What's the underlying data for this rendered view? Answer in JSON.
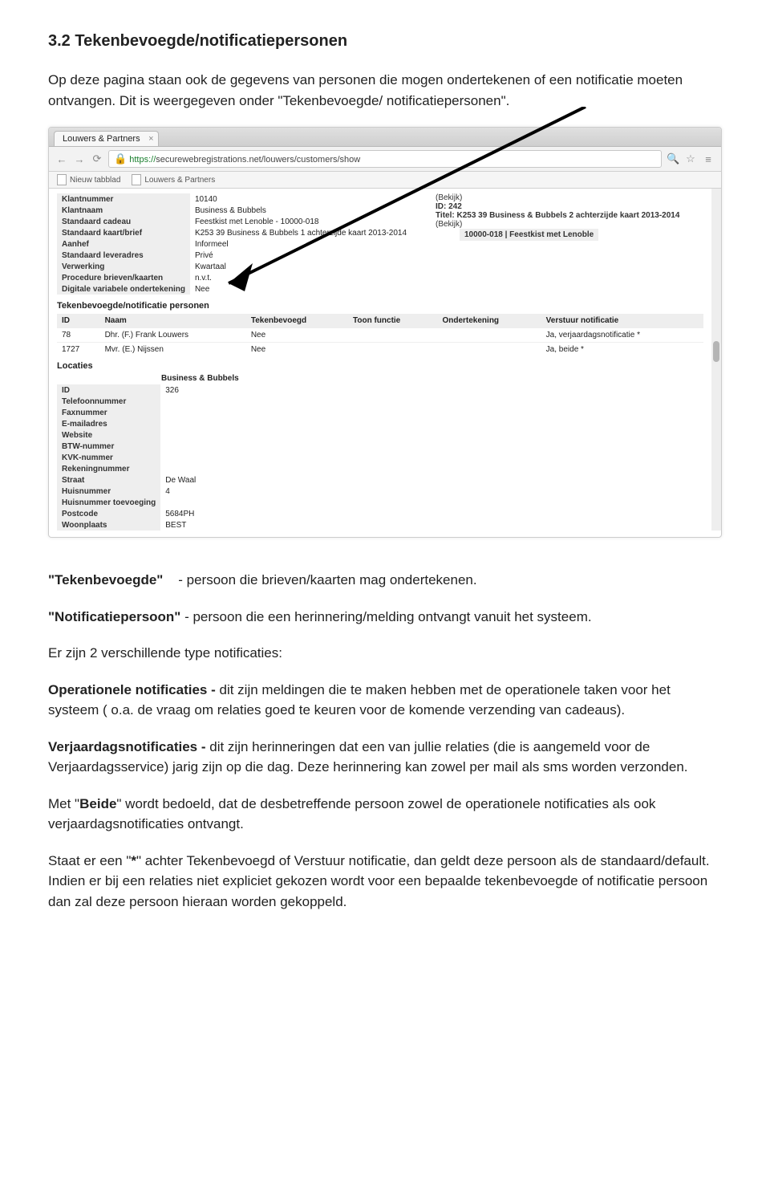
{
  "section_title": "3.2 Tekenbevoegde/notificatiepersonen",
  "intro1": "Op deze pagina staan ook de gegevens van  personen die mogen ondertekenen of een notificatie moeten ontvangen. Dit is weergegeven onder \"Tekenbevoegde/ notificatiepersonen\".",
  "browser": {
    "tab": "Louwers & Partners",
    "url_prefix": "https://",
    "url_rest": "securewebregistrations.net/louwers/customers/show",
    "bookmark1": "Nieuw tabblad",
    "bookmark2": "Louwers & Partners"
  },
  "details": {
    "rows": [
      {
        "k": "Klantnummer",
        "v": "10140"
      },
      {
        "k": "Klantnaam",
        "v": "Business & Bubbels"
      },
      {
        "k": "Standaard cadeau",
        "v": "Feestkist met Lenoble - 10000-018"
      },
      {
        "k": "Standaard kaart/brief",
        "v": "K253 39 Business & Bubbels 1 achterzijde kaart 2013-2014"
      },
      {
        "k": "Aanhef",
        "v": "Informeel"
      },
      {
        "k": "Standaard leveradres",
        "v": "Privé"
      },
      {
        "k": "Verwerking",
        "v": "Kwartaal"
      },
      {
        "k": "Procedure brieven/kaarten",
        "v": "n.v.t."
      },
      {
        "k": "Digitale variabele ondertekening",
        "v": "Nee"
      }
    ],
    "right": {
      "line1": "(Bekijk)",
      "id": "ID: 242",
      "title": "Titel: K253 39 Business & Bubbels 2 achterzijde kaart 2013-2014",
      "line2": "(Bekijk)",
      "chip": "10000-018 | Feestkist met Lenoble"
    }
  },
  "personen": {
    "heading": "Tekenbevoegde/notificatie personen",
    "columns": [
      "ID",
      "Naam",
      "Tekenbevoegd",
      "Toon functie",
      "Ondertekening",
      "Verstuur notificatie"
    ],
    "rows": [
      {
        "id": "78",
        "naam": "Dhr. (F.) Frank Louwers",
        "tb": "Nee",
        "toon": "",
        "onder": "",
        "notif": "Ja, verjaardagsnotificatie *"
      },
      {
        "id": "1727",
        "naam": "Mvr. (E.) Nijssen",
        "tb": "Nee",
        "toon": "",
        "onder": "",
        "notif": "Ja, beide *"
      }
    ]
  },
  "locaties": {
    "heading": "Locaties",
    "name": "Business & Bubbels",
    "rows": [
      {
        "k": "ID",
        "v": "326"
      },
      {
        "k": "Telefoonnummer",
        "v": ""
      },
      {
        "k": "Faxnummer",
        "v": ""
      },
      {
        "k": "E-mailadres",
        "v": ""
      },
      {
        "k": "Website",
        "v": ""
      },
      {
        "k": "BTW-nummer",
        "v": ""
      },
      {
        "k": "KVK-nummer",
        "v": ""
      },
      {
        "k": "Rekeningnummer",
        "v": ""
      },
      {
        "k": "Straat",
        "v": "De Waal"
      },
      {
        "k": "Huisnummer",
        "v": "4"
      },
      {
        "k": "Huisnummer toevoeging",
        "v": ""
      },
      {
        "k": "Postcode",
        "v": "5684PH"
      },
      {
        "k": "Woonplaats",
        "v": "BEST"
      }
    ]
  },
  "def": {
    "tb_label": "\"Tekenbevoegde\"",
    "tb_text": "    - persoon die brieven/kaarten mag ondertekenen.",
    "np_label": "\"Notificatiepersoon\"",
    "np_text": " - persoon die een herinnering/melding ontvangt vanuit het systeem."
  },
  "body": {
    "p3": "Er zijn 2 verschillende type notificaties:",
    "op_label": "Operationele notificaties - ",
    "op_text": "dit zijn meldingen die te maken hebben met de operationele taken voor het systeem ( o.a. de vraag om relaties goed te keuren voor de komende verzending van cadeaus).",
    "vj_label": "Verjaardagsnotificaties - ",
    "vj_text": "dit zijn herinneringen dat een van jullie relaties (die is aangemeld voor de Verjaardagsservice) jarig zijn op die dag. Deze herinnering kan zowel per mail als sms worden verzonden.",
    "p6a": "Met \"",
    "p6b": "Beide",
    "p6c": "\" wordt bedoeld, dat de desbetreffende persoon zowel de operationele notificaties als ook verjaardagsnotificaties ontvangt.",
    "p7a": "Staat er een \"",
    "p7b": "*",
    "p7c": "\" achter  Tekenbevoegd of Verstuur notificatie, dan geldt deze persoon als de standaard/default.  Indien er bij een relaties niet expliciet gekozen wordt voor een bepaalde tekenbevoegde of notificatie persoon dan zal deze persoon hieraan worden gekoppeld."
  }
}
